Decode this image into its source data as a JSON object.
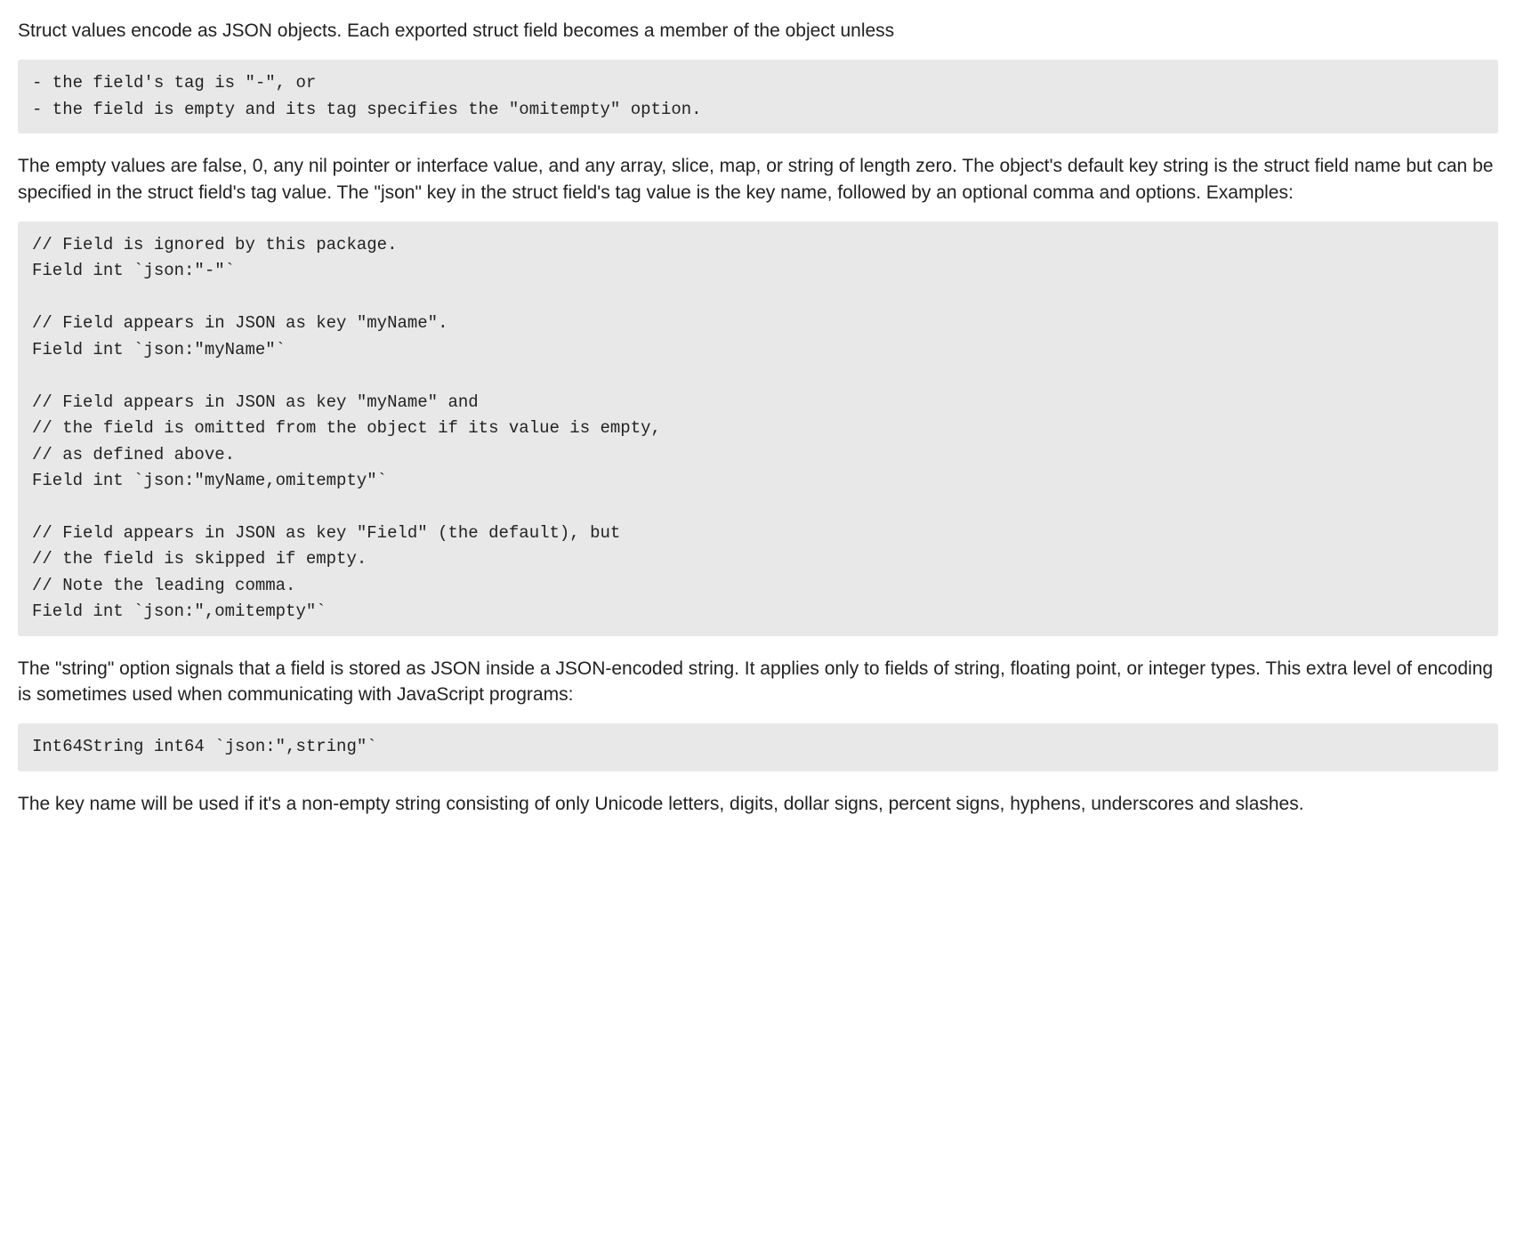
{
  "para1": "Struct values encode as JSON objects. Each exported struct field becomes a member of the object unless",
  "code1": "- the field's tag is \"-\", or\n- the field is empty and its tag specifies the \"omitempty\" option.",
  "para2": "The empty values are false, 0, any nil pointer or interface value, and any array, slice, map, or string of length zero. The object's default key string is the struct field name but can be specified in the struct field's tag value. The \"json\" key in the struct field's tag value is the key name, followed by an optional comma and options. Examples:",
  "code2": "// Field is ignored by this package.\nField int `json:\"-\"`\n\n// Field appears in JSON as key \"myName\".\nField int `json:\"myName\"`\n\n// Field appears in JSON as key \"myName\" and\n// the field is omitted from the object if its value is empty,\n// as defined above.\nField int `json:\"myName,omitempty\"`\n\n// Field appears in JSON as key \"Field\" (the default), but\n// the field is skipped if empty.\n// Note the leading comma.\nField int `json:\",omitempty\"`",
  "para3": "The \"string\" option signals that a field is stored as JSON inside a JSON-encoded string. It applies only to fields of string, floating point, or integer types. This extra level of encoding is sometimes used when communicating with JavaScript programs:",
  "code3": "Int64String int64 `json:\",string\"`",
  "para4": "The key name will be used if it's a non-empty string consisting of only Unicode letters, digits, dollar signs, percent signs, hyphens, underscores and slashes."
}
